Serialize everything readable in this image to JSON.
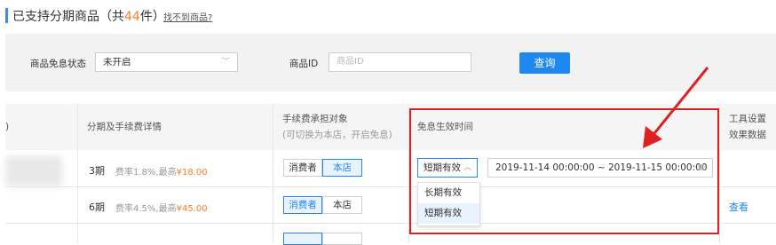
{
  "header": {
    "title_prefix": "已支持分期商品（共",
    "count": "44",
    "title_suffix": "件）",
    "not_found_link": "找不到商品?"
  },
  "filters": {
    "status_label": "商品免息状态",
    "status_value": "未开启",
    "product_id_label": "商品ID",
    "product_id_placeholder": "商品ID",
    "search_button": "查询"
  },
  "table": {
    "col_cut": ")",
    "col_installment": "分期及手续费详情",
    "col_fee_bearer": "手续费承担对象",
    "col_fee_bearer_note": "(可切换为本店，开启免息)",
    "col_effective_time": "免息生效时间",
    "col_tools_line1": "工具设置",
    "col_tools_line2": "效果数据"
  },
  "rows": [
    {
      "period": "3期",
      "rate": "费率1.8%,最高",
      "max": "¥18.00",
      "opt1": "消费者",
      "opt2": "本店",
      "selected": "本店",
      "validity": "短期有效",
      "range": "2019-11-14 00:00:00 ~ 2019-11-15 00:00:00"
    },
    {
      "period": "6期",
      "rate": "费率4.5%,最高",
      "max": "¥45.00",
      "opt1": "消费者",
      "opt2": "本店",
      "selected": "消费者",
      "action": "查看"
    },
    {
      "period": "",
      "rate": "",
      "max": "",
      "opt1": "",
      "opt2": "",
      "selected": "消费者"
    }
  ],
  "dropdown_options": [
    "长期有效",
    "短期有效"
  ],
  "colors": {
    "accent": "#1e87f0",
    "orange": "#f47d2c",
    "highlight_red": "#e02020"
  }
}
